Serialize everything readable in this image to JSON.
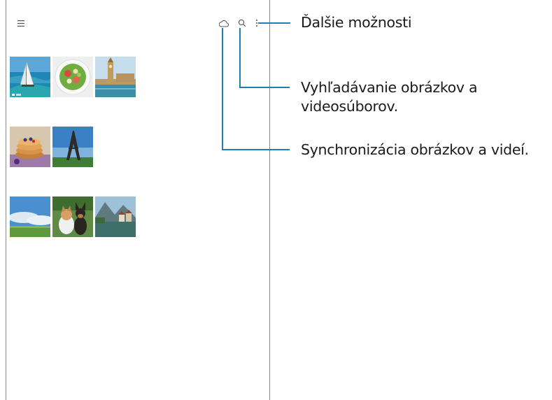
{
  "app": {
    "toolbar": {
      "menu_icon": "hamburger-menu-icon",
      "sync_icon": "cloud-icon",
      "search_icon": "search-icon",
      "more_icon": "more-options-icon"
    },
    "groups": [
      {
        "date": "",
        "thumbnails": [
          "sailboat-sea-photo",
          "salad-bowl-photo",
          "big-ben-photo"
        ]
      },
      {
        "date": "",
        "thumbnails": [
          "pancakes-photo",
          "eiffel-tower-photo"
        ]
      },
      {
        "date": "",
        "thumbnails": [
          "meadow-sky-photo",
          "cat-and-dog-photo",
          "lakeside-village-photo"
        ]
      }
    ]
  },
  "callouts": {
    "more_options": "Ďalšie možnosti",
    "search_line1": "Vyhľadávanie obrázkov a",
    "search_line2": "videosúborov.",
    "sync": "Synchronizácia obrázkov a videí."
  },
  "colors": {
    "callout_line": "#1c7fb5",
    "frame": "#8a8a8a"
  }
}
